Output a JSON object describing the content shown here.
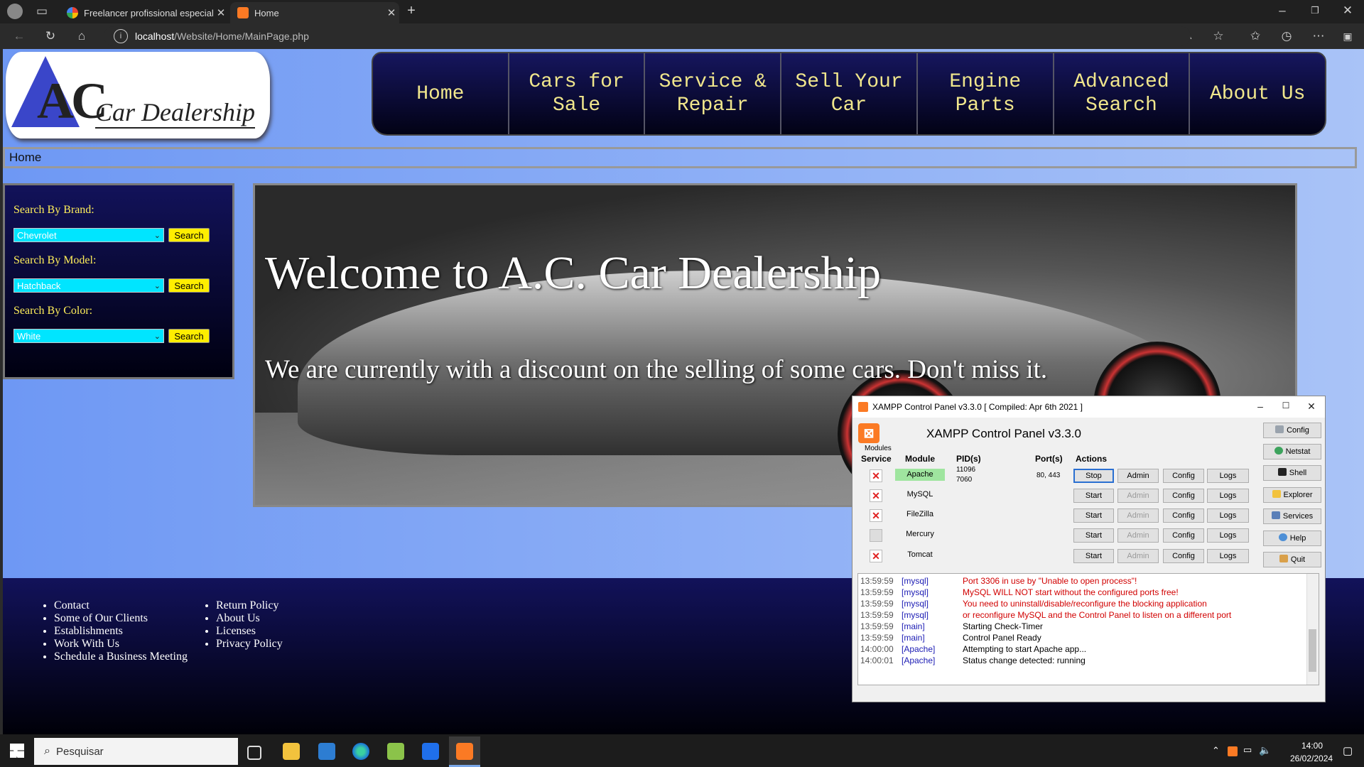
{
  "browser": {
    "tabs": [
      {
        "title": "Freelancer profissional especialis",
        "favicon_color": "#ea4335",
        "active": false
      },
      {
        "title": "Home",
        "favicon_color": "#fb7a24",
        "active": true
      }
    ],
    "url_host": "localhost",
    "url_path": "/Website/Home/MainPage.php"
  },
  "site": {
    "logo": {
      "letters": "AC",
      "tagline": "Car Dealership"
    },
    "nav": [
      "Home",
      "Cars for Sale",
      "Service & Repair",
      "Sell Your Car",
      "Engine Parts",
      "Advanced Search",
      "About Us"
    ],
    "breadcrumb": "Home",
    "sidebar": {
      "brand_label": "Search By Brand:",
      "brand_value": "Chevrolet",
      "model_label": "Search By Model:",
      "model_value": "Hatchback",
      "color_label": "Search By Color:",
      "color_value": "White",
      "search_label": "Search"
    },
    "hero": {
      "title": "Welcome to A.C. Car Dealership",
      "subtitle": "We are currently with a discount on the selling of some cars. Don't miss it."
    },
    "footer": {
      "col1": [
        "Contact",
        "Some of Our Clients",
        "Establishments",
        "Work With Us",
        "Schedule a Business Meeting"
      ],
      "col2": [
        "Return Policy",
        "About Us",
        "Licenses",
        "Privacy Policy"
      ]
    },
    "colors": {
      "nav_text": "#f0e68c",
      "sidebar_label": "#ffef5a",
      "select_bg": "#00e5ff",
      "button_bg": "#ffee00"
    }
  },
  "xampp": {
    "window_title": "XAMPP Control Panel v3.3.0   [ Compiled: Apr 6th 2021 ]",
    "header": "XAMPP Control Panel v3.3.0",
    "modules_label": "Modules",
    "col_service": "Service",
    "col_module": "Module",
    "col_pids": "PID(s)",
    "col_ports": "Port(s)",
    "col_actions": "Actions",
    "rows": [
      {
        "module": "Apache",
        "pid1": "11096",
        "pid2": "7060",
        "ports": "80, 443",
        "action": "Stop",
        "admin": "Admin",
        "config": "Config",
        "logs": "Logs"
      },
      {
        "module": "MySQL",
        "pid1": "",
        "pid2": "",
        "ports": "",
        "action": "Start",
        "admin": "Admin",
        "config": "Config",
        "logs": "Logs"
      },
      {
        "module": "FileZilla",
        "pid1": "",
        "pid2": "",
        "ports": "",
        "action": "Start",
        "admin": "Admin",
        "config": "Config",
        "logs": "Logs"
      },
      {
        "module": "Mercury",
        "pid1": "",
        "pid2": "",
        "ports": "",
        "action": "Start",
        "admin": "Admin",
        "config": "Config",
        "logs": "Logs"
      },
      {
        "module": "Tomcat",
        "pid1": "",
        "pid2": "",
        "ports": "",
        "action": "Start",
        "admin": "Admin",
        "config": "Config",
        "logs": "Logs"
      }
    ],
    "side_buttons": [
      "Config",
      "Netstat",
      "Shell",
      "Explorer",
      "Services",
      "Help",
      "Quit"
    ],
    "log": [
      {
        "time": "13:59:59",
        "module": "[mysql]",
        "msg": "Port 3306 in use by \"Unable to open process\"!",
        "red": true
      },
      {
        "time": "13:59:59",
        "module": "[mysql]",
        "msg": "MySQL WILL NOT start without the configured ports free!",
        "red": true
      },
      {
        "time": "13:59:59",
        "module": "[mysql]",
        "msg": "You need to uninstall/disable/reconfigure the blocking application",
        "red": true
      },
      {
        "time": "13:59:59",
        "module": "[mysql]",
        "msg": "or reconfigure MySQL and the Control Panel to listen on a different port",
        "red": true
      },
      {
        "time": "13:59:59",
        "module": "[main]",
        "msg": "Starting Check-Timer",
        "red": false
      },
      {
        "time": "13:59:59",
        "module": "[main]",
        "msg": "Control Panel Ready",
        "red": false
      },
      {
        "time": "14:00:00",
        "module": "[Apache]",
        "msg": "Attempting to start Apache app...",
        "red": false
      },
      {
        "time": "14:00:01",
        "module": "[Apache]",
        "msg": "Status change detected: running",
        "red": false
      }
    ]
  },
  "taskbar": {
    "search_placeholder": "Pesquisar",
    "time": "14:00",
    "date": "26/02/2024"
  }
}
